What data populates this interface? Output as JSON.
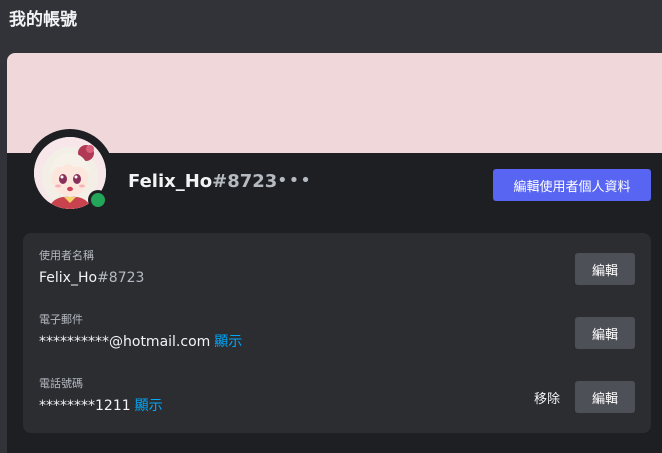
{
  "page": {
    "title": "我的帳號"
  },
  "colors": {
    "banner": "#f0d7da",
    "accent": "#5865f2",
    "online": "#23a55a",
    "link": "#00a8fc"
  },
  "profile": {
    "username": "Felix_Ho",
    "discriminator": "#8723",
    "status": "online",
    "more_icon": "more-horizontal-icon",
    "edit_profile_label": "編輯使用者個人資料"
  },
  "fields": {
    "username": {
      "label": "使用者名稱",
      "name": "Felix_Ho",
      "discriminator": "#8723",
      "edit_label": "編輯"
    },
    "email": {
      "label": "電子郵件",
      "value": "**********@hotmail.com",
      "reveal_label": "顯示",
      "edit_label": "編輯"
    },
    "phone": {
      "label": "電話號碼",
      "value": "********1211",
      "reveal_label": "顯示",
      "remove_label": "移除",
      "edit_label": "編輯"
    }
  }
}
